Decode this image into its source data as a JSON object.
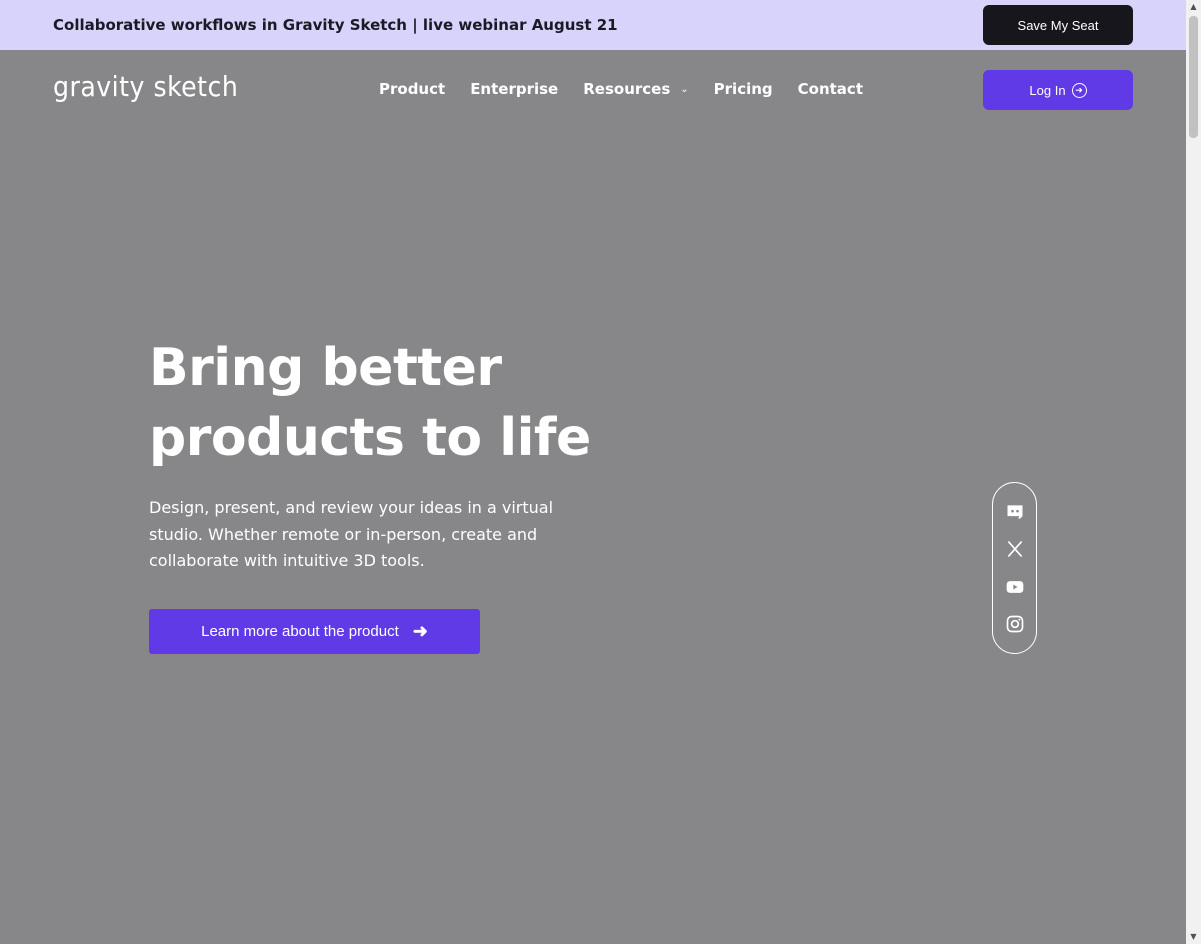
{
  "announcement": {
    "text": "Collaborative workflows in Gravity Sketch | live webinar August 21",
    "cta_label": "Save My Seat"
  },
  "nav": {
    "logo": "gravity sketch",
    "links": [
      "Product",
      "Enterprise",
      "Resources",
      "Pricing",
      "Contact"
    ],
    "login_label": "Log In"
  },
  "hero": {
    "title_line1": "Bring better",
    "title_line2": "products to life",
    "subtitle": "Design, present, and review your ideas in a virtual studio. Whether remote or in-person, create and collaborate with intuitive 3D tools.",
    "cta_label": "Learn more about the product"
  },
  "social": {
    "icons": [
      "discord-icon",
      "x-icon",
      "youtube-icon",
      "instagram-icon"
    ]
  },
  "colors": {
    "announce_bg": "#d7d3fb",
    "hero_bg": "#878789",
    "accent": "#5f3ae6",
    "dark_button": "#17161c"
  }
}
